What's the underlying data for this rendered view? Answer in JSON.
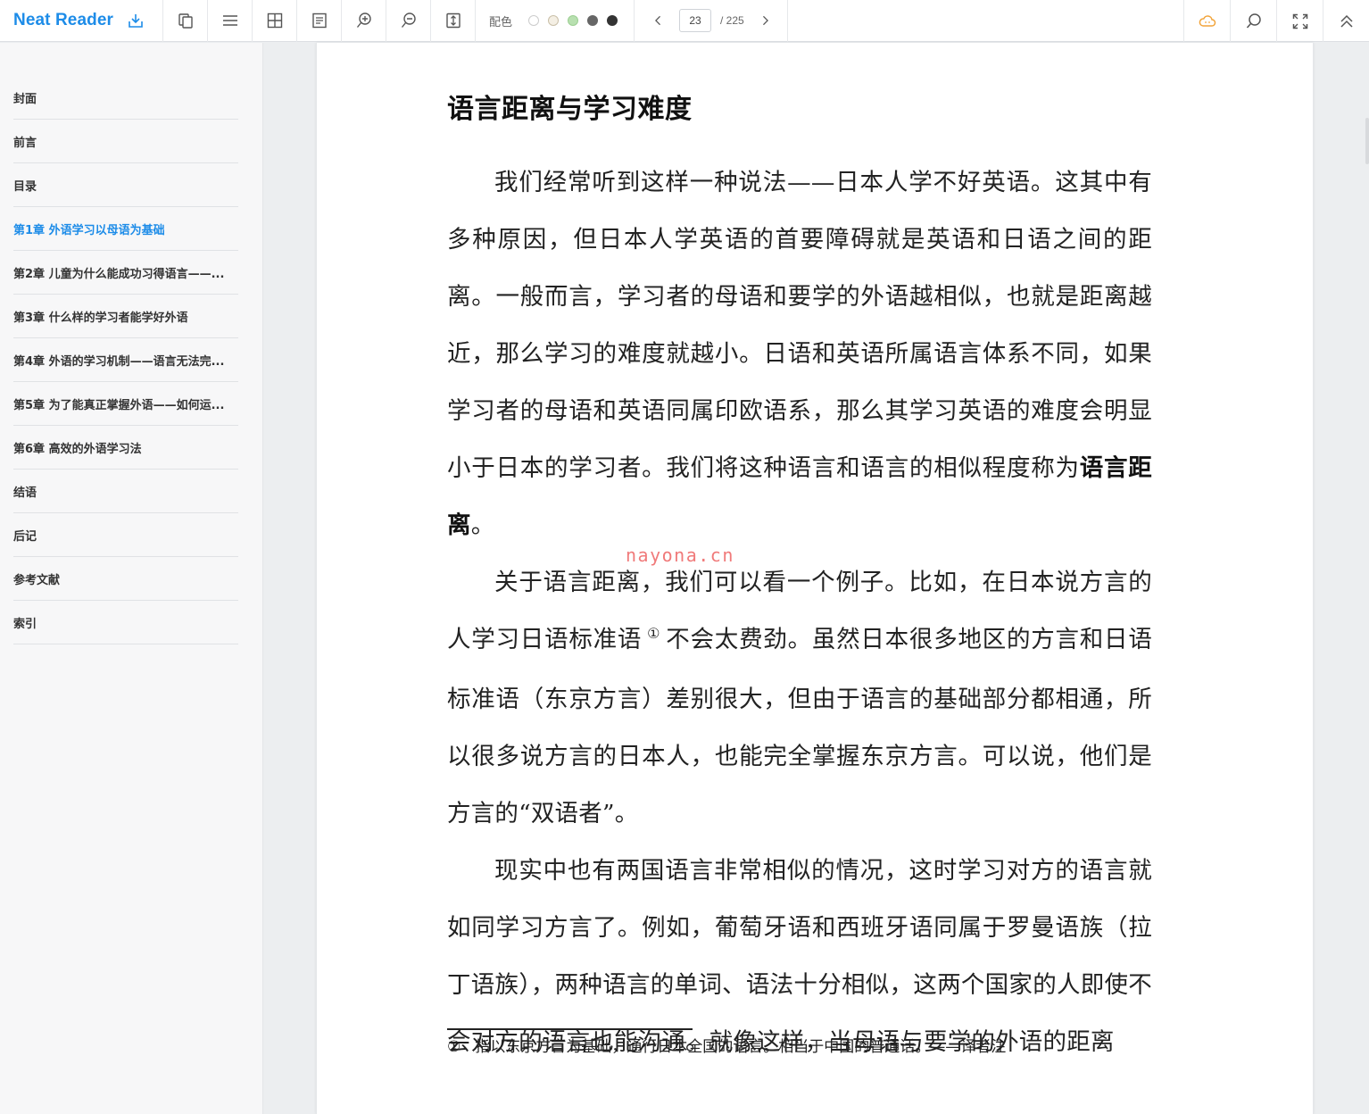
{
  "app": {
    "name": "Neat Reader"
  },
  "toolbar": {
    "theme_label": "配色",
    "theme_swatches": [
      "#ffffff",
      "#f1ece2",
      "#b8e0b0",
      "#666666",
      "#333333"
    ],
    "page_current": "23",
    "page_total": "/ 225",
    "accent": "#1d8ce8"
  },
  "sidebar": {
    "items": [
      {
        "label": "封面"
      },
      {
        "label": "前言"
      },
      {
        "label": "目录"
      },
      {
        "label": "第1章 外语学习以母语为基础",
        "active": true
      },
      {
        "label": "第2章 儿童为什么能成功习得语言——..."
      },
      {
        "label": "第3章 什么样的学习者能学好外语"
      },
      {
        "label": "第4章 外语的学习机制——语言无法完..."
      },
      {
        "label": "第5章 为了能真正掌握外语——如何运..."
      },
      {
        "label": "第6章 高效的外语学习法"
      },
      {
        "label": "结语"
      },
      {
        "label": "后记"
      },
      {
        "label": "参考文献"
      },
      {
        "label": "索引"
      }
    ]
  },
  "content": {
    "title": "语言距离与学习难度",
    "para1_text": "我们经常听到这样一种说法——日本人学不好英语。这其中有多种原因，但日本人学英语的首要障碍就是英语和日语之间的距离。一般而言，学习者的母语和要学的外语越相似，也就是距离越近，那么学习的难度就越小。日语和英语所属语言体系不同，如果学习者的母语和英语同属印欧语系，那么其学习英语的难度会明显小于日本的学习者。我们将这种语言和语言的相似程度称为",
    "para1_bold": "语言距离",
    "para1_end": "。",
    "para2_before": "关于语言距离，我们可以看一个例子。比如，在日本说方言的人学习日语标准语",
    "para2_sup": "①",
    "para2_after": "不会太费劲。虽然日本很多地区的方言和日语标准语（东京方言）差别很大，但由于语言的基础部分都相通，所以很多说方言的日本人，也能完全掌握东京方言。可以说，他们是方言的“双语者”。",
    "para3": "现实中也有两国语言非常相似的情况，这时学习对方的语言就如同学习方言了。例如，葡萄牙语和西班牙语同属于罗曼语族（拉丁语族），两种语言的单词、语法十分相似，这两个国家的人即使不会对方的语言也能沟通。就像这样，当母语与要学的外语的距离",
    "footnote_mark": "①",
    "footnote_text": "指以东京方言为基础，通行日本全国的语言。相当于中国的普通话。——译者注",
    "watermark": "nayona.cn"
  }
}
